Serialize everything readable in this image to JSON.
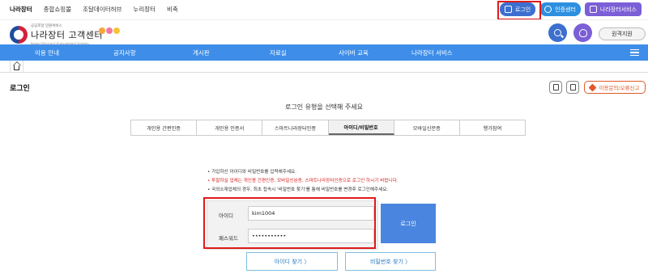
{
  "topbar": {
    "links": [
      "나라장터",
      "종합쇼핑몰",
      "조달데이터허브",
      "누리장터",
      "비축"
    ],
    "login_label": "로그인",
    "cert_label": "인증센터",
    "service_label": "나라장터서비스"
  },
  "logo": {
    "small_text": "공공조달 민원서비스",
    "title": "나라장터 고객센터",
    "english": "Korea ON-Line E-Procurement System"
  },
  "remote_support": "원격지원",
  "nav": [
    "이용 안내",
    "공지사항",
    "게시판",
    "자료실",
    "사이버 교육",
    "나라장터 서비스"
  ],
  "page": {
    "title": "로그인",
    "report_label": "이용문의/오류신고",
    "subtitle": "로그인 유형을 선택해 주세요"
  },
  "tabs": [
    {
      "label": "개인용 간편인증",
      "active": false
    },
    {
      "label": "개인용 인증서",
      "active": false
    },
    {
      "label": "스마트나라장터인증",
      "active": false
    },
    {
      "label": "아이디/비밀번호",
      "active": true
    },
    {
      "label": "모바일신분증",
      "active": false
    },
    {
      "label": "행가참여",
      "active": false
    }
  ],
  "notices": [
    {
      "text": "• 가입하신 아이디와 비밀번호를 입력해주세요.",
      "red": false
    },
    {
      "text": "• 투찰하실 업체는 개인용 간편인증, 모바일신분증, 스마트나라장터인증으로 로그인 하시기 바랍니다.",
      "red": true
    },
    {
      "text": "• 국외소재업체의 경우, 최초 접속시 '비밀번호 찾기'를 통해 비밀번호를 변경후 로그인해주세요.",
      "red": false
    }
  ],
  "form": {
    "id_label": "아이디",
    "id_value": "kim1004",
    "pw_label": "패스워드",
    "pw_value": "•••••••••••",
    "login_button": "로그인",
    "find_id": "아이디 찾기 〉",
    "find_pw": "비밀번호 찾기 〉"
  },
  "colors": {
    "nav_blue": "#3e8ee9",
    "login_button": "#4a86e0",
    "highlight_red": "#e01a1a"
  }
}
